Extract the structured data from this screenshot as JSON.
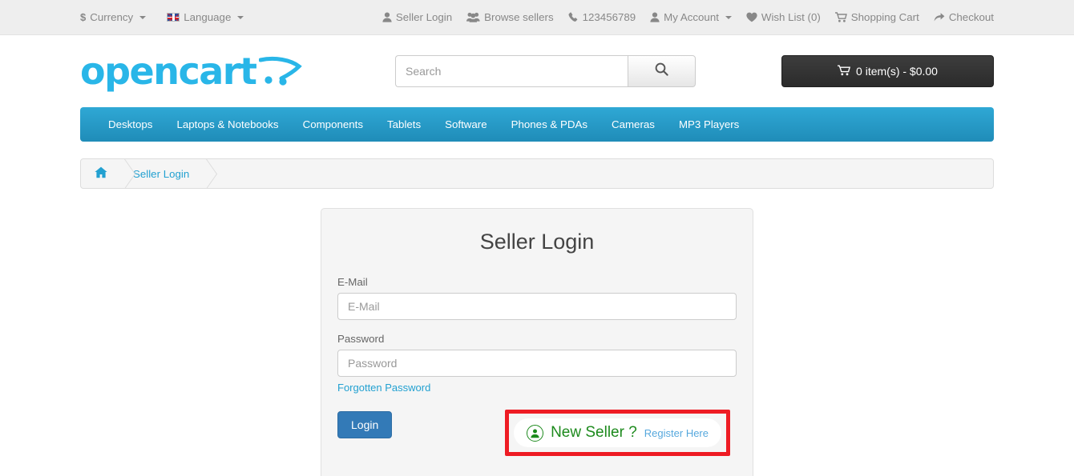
{
  "topbar": {
    "left": [
      {
        "label": "Currency",
        "icon": "dollar-icon",
        "caret": true
      },
      {
        "label": "Language",
        "icon": "uk-flag-icon",
        "caret": true
      }
    ],
    "right": [
      {
        "label": "Seller Login",
        "icon": "user-icon",
        "caret": false
      },
      {
        "label": "Browse sellers",
        "icon": "users-icon",
        "caret": false
      },
      {
        "label": "123456789",
        "icon": "phone-icon",
        "caret": false
      },
      {
        "label": "My Account",
        "icon": "user-icon",
        "caret": true
      },
      {
        "label": "Wish List (0)",
        "icon": "heart-icon",
        "caret": false
      },
      {
        "label": "Shopping Cart",
        "icon": "cart-icon",
        "caret": false
      },
      {
        "label": "Checkout",
        "icon": "arrow-share-icon",
        "caret": false
      }
    ],
    "currency_symbol": "$"
  },
  "header": {
    "logo_text": "opencart",
    "logo_icon": "shopping-cart-swoosh-icon",
    "search": {
      "placeholder": "Search",
      "value": "",
      "button_icon": "search-icon"
    },
    "cart": {
      "label": "0 item(s) - $0.00",
      "icon": "cart-icon"
    }
  },
  "nav": {
    "items": [
      "Desktops",
      "Laptops & Notebooks",
      "Components",
      "Tablets",
      "Software",
      "Phones & PDAs",
      "Cameras",
      "MP3 Players"
    ]
  },
  "breadcrumb": {
    "home_icon": "home-icon",
    "items": [
      "Seller Login"
    ]
  },
  "login_panel": {
    "title": "Seller Login",
    "email": {
      "label": "E-Mail",
      "placeholder": "E-Mail",
      "value": ""
    },
    "password": {
      "label": "Password",
      "placeholder": "Password",
      "value": ""
    },
    "forgotten_password": "Forgotten Password",
    "login_button": "Login",
    "new_seller": {
      "icon": "user-circle-icon",
      "text": "New Seller ?",
      "link": "Register Here",
      "highlighted": true
    }
  },
  "colors": {
    "brand_logo": "#29b6e8",
    "nav_bar": "#23a1d1",
    "link": "#23a1d1",
    "login_button": "#337ab7",
    "highlight_box": "#ee1c24",
    "new_seller_green": "#1d8a1d",
    "register_link": "#56a8dd",
    "topbar_bg": "#eeeeee",
    "panel_bg": "#f5f5f5",
    "cart_button_bg": "#2b2b2b"
  }
}
